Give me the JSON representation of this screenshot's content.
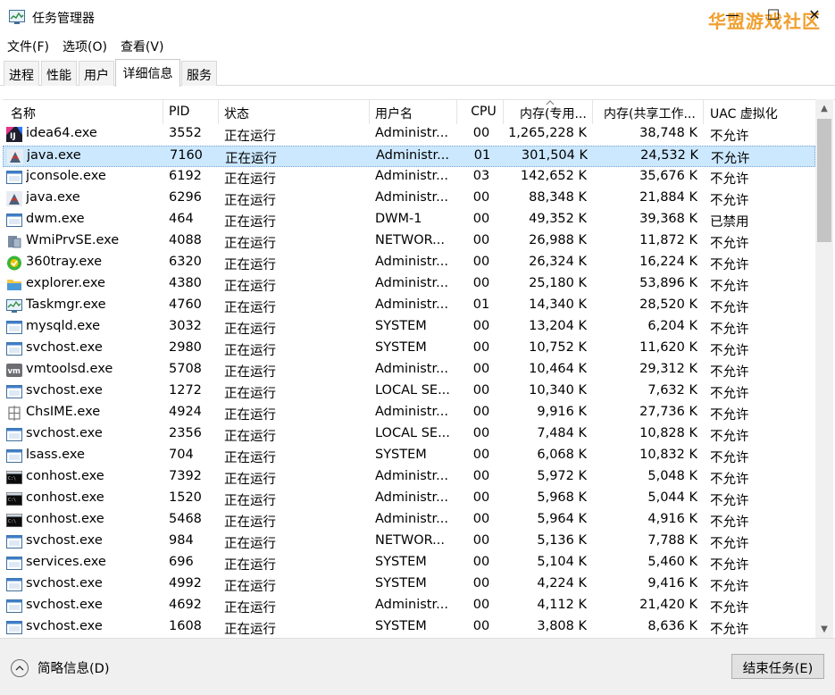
{
  "window": {
    "title": "任务管理器",
    "watermark": "华盟游戏社区",
    "minimize": "—",
    "maximize": "☐",
    "close": "✕"
  },
  "menu": [
    "文件(F)",
    "选项(O)",
    "查看(V)"
  ],
  "tabs": [
    {
      "label": "进程",
      "active": false
    },
    {
      "label": "性能",
      "active": false
    },
    {
      "label": "用户",
      "active": false
    },
    {
      "label": "详细信息",
      "active": true
    },
    {
      "label": "服务",
      "active": false
    }
  ],
  "columns": [
    "名称",
    "PID",
    "状态",
    "用户名",
    "CPU",
    "内存(专用...",
    "内存(共享工作...",
    "UAC 虚拟化"
  ],
  "processes": [
    {
      "name": "idea64.exe",
      "pid": "3552",
      "status": "正在运行",
      "user": "Administr...",
      "cpu": "00",
      "mem_private": "1,265,228 K",
      "mem_shared": "38,748 K",
      "uac": "不允许",
      "icon": "idea-icon",
      "selected": false
    },
    {
      "name": "java.exe",
      "pid": "7160",
      "status": "正在运行",
      "user": "Administr...",
      "cpu": "01",
      "mem_private": "301,504 K",
      "mem_shared": "24,532 K",
      "uac": "不允许",
      "icon": "java-icon",
      "selected": true
    },
    {
      "name": "jconsole.exe",
      "pid": "6192",
      "status": "正在运行",
      "user": "Administr...",
      "cpu": "03",
      "mem_private": "142,652 K",
      "mem_shared": "35,676 K",
      "uac": "不允许",
      "icon": "window-icon",
      "selected": false
    },
    {
      "name": "java.exe",
      "pid": "6296",
      "status": "正在运行",
      "user": "Administr...",
      "cpu": "00",
      "mem_private": "88,348 K",
      "mem_shared": "21,884 K",
      "uac": "不允许",
      "icon": "java-icon",
      "selected": false
    },
    {
      "name": "dwm.exe",
      "pid": "464",
      "status": "正在运行",
      "user": "DWM-1",
      "cpu": "00",
      "mem_private": "49,352 K",
      "mem_shared": "39,368 K",
      "uac": "已禁用",
      "icon": "window-icon",
      "selected": false
    },
    {
      "name": "WmiPrvSE.exe",
      "pid": "4088",
      "status": "正在运行",
      "user": "NETWOR...",
      "cpu": "00",
      "mem_private": "26,988 K",
      "mem_shared": "11,872 K",
      "uac": "不允许",
      "icon": "wmi-icon",
      "selected": false
    },
    {
      "name": "360tray.exe",
      "pid": "6320",
      "status": "正在运行",
      "user": "Administr...",
      "cpu": "00",
      "mem_private": "26,324 K",
      "mem_shared": "16,224 K",
      "uac": "不允许",
      "icon": "360-icon",
      "selected": false
    },
    {
      "name": "explorer.exe",
      "pid": "4380",
      "status": "正在运行",
      "user": "Administr...",
      "cpu": "00",
      "mem_private": "25,180 K",
      "mem_shared": "53,896 K",
      "uac": "不允许",
      "icon": "folder-icon",
      "selected": false
    },
    {
      "name": "Taskmgr.exe",
      "pid": "4760",
      "status": "正在运行",
      "user": "Administr...",
      "cpu": "01",
      "mem_private": "14,340 K",
      "mem_shared": "28,520 K",
      "uac": "不允许",
      "icon": "taskmgr-icon",
      "selected": false
    },
    {
      "name": "mysqld.exe",
      "pid": "3032",
      "status": "正在运行",
      "user": "SYSTEM",
      "cpu": "00",
      "mem_private": "13,204 K",
      "mem_shared": "6,204 K",
      "uac": "不允许",
      "icon": "window-icon",
      "selected": false
    },
    {
      "name": "svchost.exe",
      "pid": "2980",
      "status": "正在运行",
      "user": "SYSTEM",
      "cpu": "00",
      "mem_private": "10,752 K",
      "mem_shared": "11,620 K",
      "uac": "不允许",
      "icon": "window-icon",
      "selected": false
    },
    {
      "name": "vmtoolsd.exe",
      "pid": "5708",
      "status": "正在运行",
      "user": "Administr...",
      "cpu": "00",
      "mem_private": "10,464 K",
      "mem_shared": "29,312 K",
      "uac": "不允许",
      "icon": "vm-icon",
      "selected": false
    },
    {
      "name": "svchost.exe",
      "pid": "1272",
      "status": "正在运行",
      "user": "LOCAL SE...",
      "cpu": "00",
      "mem_private": "10,340 K",
      "mem_shared": "7,632 K",
      "uac": "不允许",
      "icon": "window-icon",
      "selected": false
    },
    {
      "name": "ChsIME.exe",
      "pid": "4924",
      "status": "正在运行",
      "user": "Administr...",
      "cpu": "00",
      "mem_private": "9,916 K",
      "mem_shared": "27,736 K",
      "uac": "不允许",
      "icon": "ime-icon",
      "selected": false
    },
    {
      "name": "svchost.exe",
      "pid": "2356",
      "status": "正在运行",
      "user": "LOCAL SE...",
      "cpu": "00",
      "mem_private": "7,484 K",
      "mem_shared": "10,828 K",
      "uac": "不允许",
      "icon": "window-icon",
      "selected": false
    },
    {
      "name": "lsass.exe",
      "pid": "704",
      "status": "正在运行",
      "user": "SYSTEM",
      "cpu": "00",
      "mem_private": "6,068 K",
      "mem_shared": "10,832 K",
      "uac": "不允许",
      "icon": "window-icon",
      "selected": false
    },
    {
      "name": "conhost.exe",
      "pid": "7392",
      "status": "正在运行",
      "user": "Administr...",
      "cpu": "00",
      "mem_private": "5,972 K",
      "mem_shared": "5,048 K",
      "uac": "不允许",
      "icon": "console-icon",
      "selected": false
    },
    {
      "name": "conhost.exe",
      "pid": "1520",
      "status": "正在运行",
      "user": "Administr...",
      "cpu": "00",
      "mem_private": "5,968 K",
      "mem_shared": "5,044 K",
      "uac": "不允许",
      "icon": "console-icon",
      "selected": false
    },
    {
      "name": "conhost.exe",
      "pid": "5468",
      "status": "正在运行",
      "user": "Administr...",
      "cpu": "00",
      "mem_private": "5,964 K",
      "mem_shared": "4,916 K",
      "uac": "不允许",
      "icon": "console-icon",
      "selected": false
    },
    {
      "name": "svchost.exe",
      "pid": "984",
      "status": "正在运行",
      "user": "NETWOR...",
      "cpu": "00",
      "mem_private": "5,136 K",
      "mem_shared": "7,788 K",
      "uac": "不允许",
      "icon": "window-icon",
      "selected": false
    },
    {
      "name": "services.exe",
      "pid": "696",
      "status": "正在运行",
      "user": "SYSTEM",
      "cpu": "00",
      "mem_private": "5,104 K",
      "mem_shared": "5,460 K",
      "uac": "不允许",
      "icon": "window-icon",
      "selected": false
    },
    {
      "name": "svchost.exe",
      "pid": "4992",
      "status": "正在运行",
      "user": "SYSTEM",
      "cpu": "00",
      "mem_private": "4,224 K",
      "mem_shared": "9,416 K",
      "uac": "不允许",
      "icon": "window-icon",
      "selected": false
    },
    {
      "name": "svchost.exe",
      "pid": "4692",
      "status": "正在运行",
      "user": "Administr...",
      "cpu": "00",
      "mem_private": "4,112 K",
      "mem_shared": "21,420 K",
      "uac": "不允许",
      "icon": "window-icon",
      "selected": false
    },
    {
      "name": "svchost.exe",
      "pid": "1608",
      "status": "正在运行",
      "user": "SYSTEM",
      "cpu": "00",
      "mem_private": "3,808 K",
      "mem_shared": "8,636 K",
      "uac": "不允许",
      "icon": "window-icon",
      "selected": false
    }
  ],
  "footer": {
    "fewer_details": "简略信息(D)",
    "end_task": "结束任务(E)"
  },
  "colors": {
    "selection": "#cce8ff",
    "watermark": "#f0a030",
    "footer_bg": "#f0f0f0"
  }
}
